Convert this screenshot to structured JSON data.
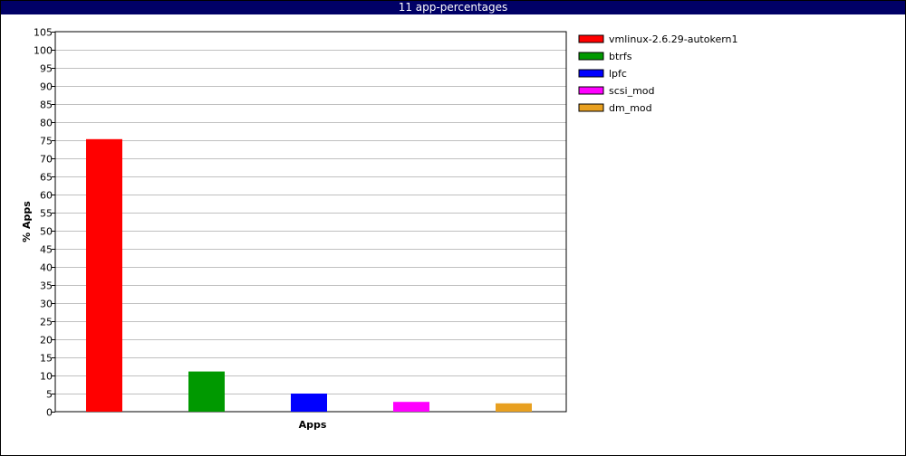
{
  "chart_data": {
    "type": "bar",
    "title": "11 app-percentages",
    "xlabel": "Apps",
    "ylabel": "% Apps",
    "ylim": [
      0,
      105
    ],
    "ytick_step": 5,
    "grid": true,
    "legend_position": "right",
    "series": [
      {
        "name": "vmlinux-2.6.29-autokern1",
        "value": 75.3,
        "color": "#ff0000"
      },
      {
        "name": "btrfs",
        "value": 11.1,
        "color": "#009900"
      },
      {
        "name": "lpfc",
        "value": 5.0,
        "color": "#0000ff"
      },
      {
        "name": "scsi_mod",
        "value": 2.7,
        "color": "#ff00ff"
      },
      {
        "name": "dm_mod",
        "value": 2.3,
        "color": "#e8a020"
      }
    ]
  }
}
